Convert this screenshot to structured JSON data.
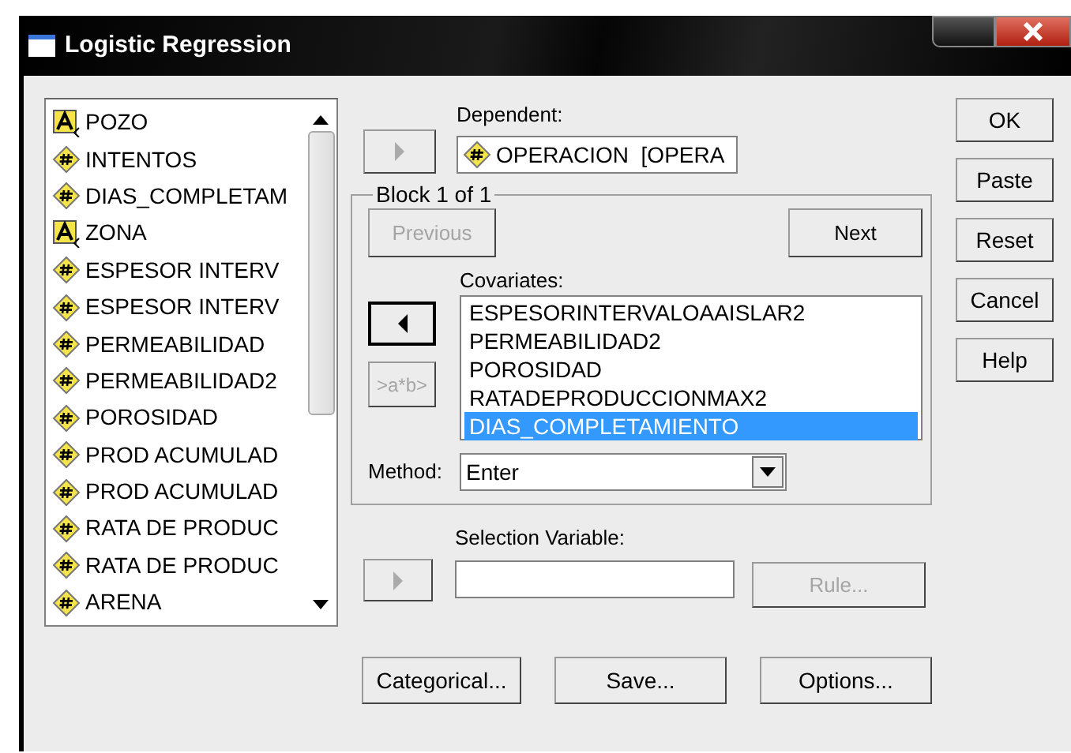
{
  "window": {
    "title": "Logistic Regression"
  },
  "variables": [
    {
      "kind": "string",
      "name": "POZO"
    },
    {
      "kind": "numeric",
      "name": "INTENTOS"
    },
    {
      "kind": "numeric",
      "name": "DIAS_COMPLETAM"
    },
    {
      "kind": "string",
      "name": "ZONA"
    },
    {
      "kind": "numeric",
      "name": "ESPESOR INTERV"
    },
    {
      "kind": "numeric",
      "name": "ESPESOR INTERV"
    },
    {
      "kind": "numeric",
      "name": "PERMEABILIDAD"
    },
    {
      "kind": "numeric",
      "name": "PERMEABILIDAD2"
    },
    {
      "kind": "numeric",
      "name": "POROSIDAD"
    },
    {
      "kind": "numeric",
      "name": "PROD ACUMULAD"
    },
    {
      "kind": "numeric",
      "name": "PROD ACUMULAD"
    },
    {
      "kind": "numeric",
      "name": "RATA DE PRODUC"
    },
    {
      "kind": "numeric",
      "name": "RATA DE PRODUC"
    },
    {
      "kind": "numeric",
      "name": "ARENA"
    }
  ],
  "dependent": {
    "label": "Dependent:",
    "kind": "numeric",
    "value": "OPERACION  [OPERA"
  },
  "block": {
    "label": "Block 1 of 1",
    "previous": {
      "label": "Previous",
      "disabled": true
    },
    "next": {
      "label": "Next",
      "disabled": false
    },
    "covariates_label": "Covariates:",
    "interaction": {
      "label": ">a*b>",
      "disabled": true
    },
    "covariates": [
      {
        "name": "ESPESORINTERVALOAAISLAR2",
        "selected": false
      },
      {
        "name": "PERMEABILIDAD2",
        "selected": false
      },
      {
        "name": "POROSIDAD",
        "selected": false
      },
      {
        "name": "RATADEPRODUCCIONMAX2",
        "selected": false
      },
      {
        "name": "DIAS_COMPLETAMIENTO",
        "selected": true
      }
    ],
    "method_label": "Method:",
    "method": "Enter"
  },
  "selection": {
    "label": "Selection Variable:",
    "rule": {
      "label": "Rule...",
      "disabled": true
    }
  },
  "bottom_buttons": [
    "Categorical...",
    "Save...",
    "Options..."
  ],
  "side_buttons": [
    "OK",
    "Paste",
    "Reset",
    "Cancel",
    "Help"
  ]
}
